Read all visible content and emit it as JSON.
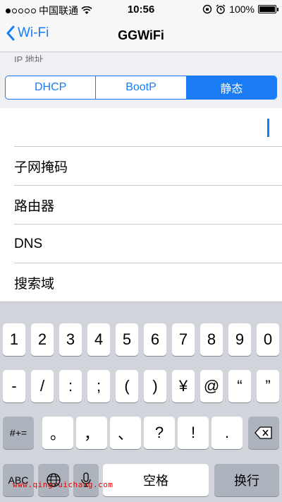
{
  "status_bar": {
    "carrier": "中国联通",
    "time": "10:56",
    "battery": "100%",
    "signal_strength": 1,
    "icons": [
      "wifi-icon",
      "orientation-lock-icon",
      "alarm-icon",
      "battery-icon"
    ]
  },
  "nav": {
    "back_label": "Wi-Fi",
    "title": "GGWiFi"
  },
  "section_label": "IP 地址",
  "segments": [
    {
      "label": "DHCP",
      "active": false
    },
    {
      "label": "BootP",
      "active": false
    },
    {
      "label": "静态",
      "active": true
    }
  ],
  "fields": [
    {
      "label": "",
      "value": ""
    },
    {
      "label": "子网掩码",
      "value": ""
    },
    {
      "label": "路由器",
      "value": ""
    },
    {
      "label": "DNS",
      "value": ""
    },
    {
      "label": "搜索域",
      "value": ""
    }
  ],
  "keyboard": {
    "row1": [
      "1",
      "2",
      "3",
      "4",
      "5",
      "6",
      "7",
      "8",
      "9",
      "0"
    ],
    "row2": [
      "-",
      "/",
      ":",
      ";",
      "(",
      ")",
      "¥",
      "@",
      "“",
      "”"
    ],
    "symbols_key": "#+=",
    "row3": [
      "。",
      "，",
      "、",
      "?",
      "!",
      "."
    ],
    "abc_key": "ABC",
    "space_key": "空格",
    "return_key": "换行"
  },
  "watermark": "www.qingruichang.com",
  "colors": {
    "accent": "#1a7cf5",
    "keyboard_bg": "#d1d5db",
    "watermark": "#e60000"
  }
}
